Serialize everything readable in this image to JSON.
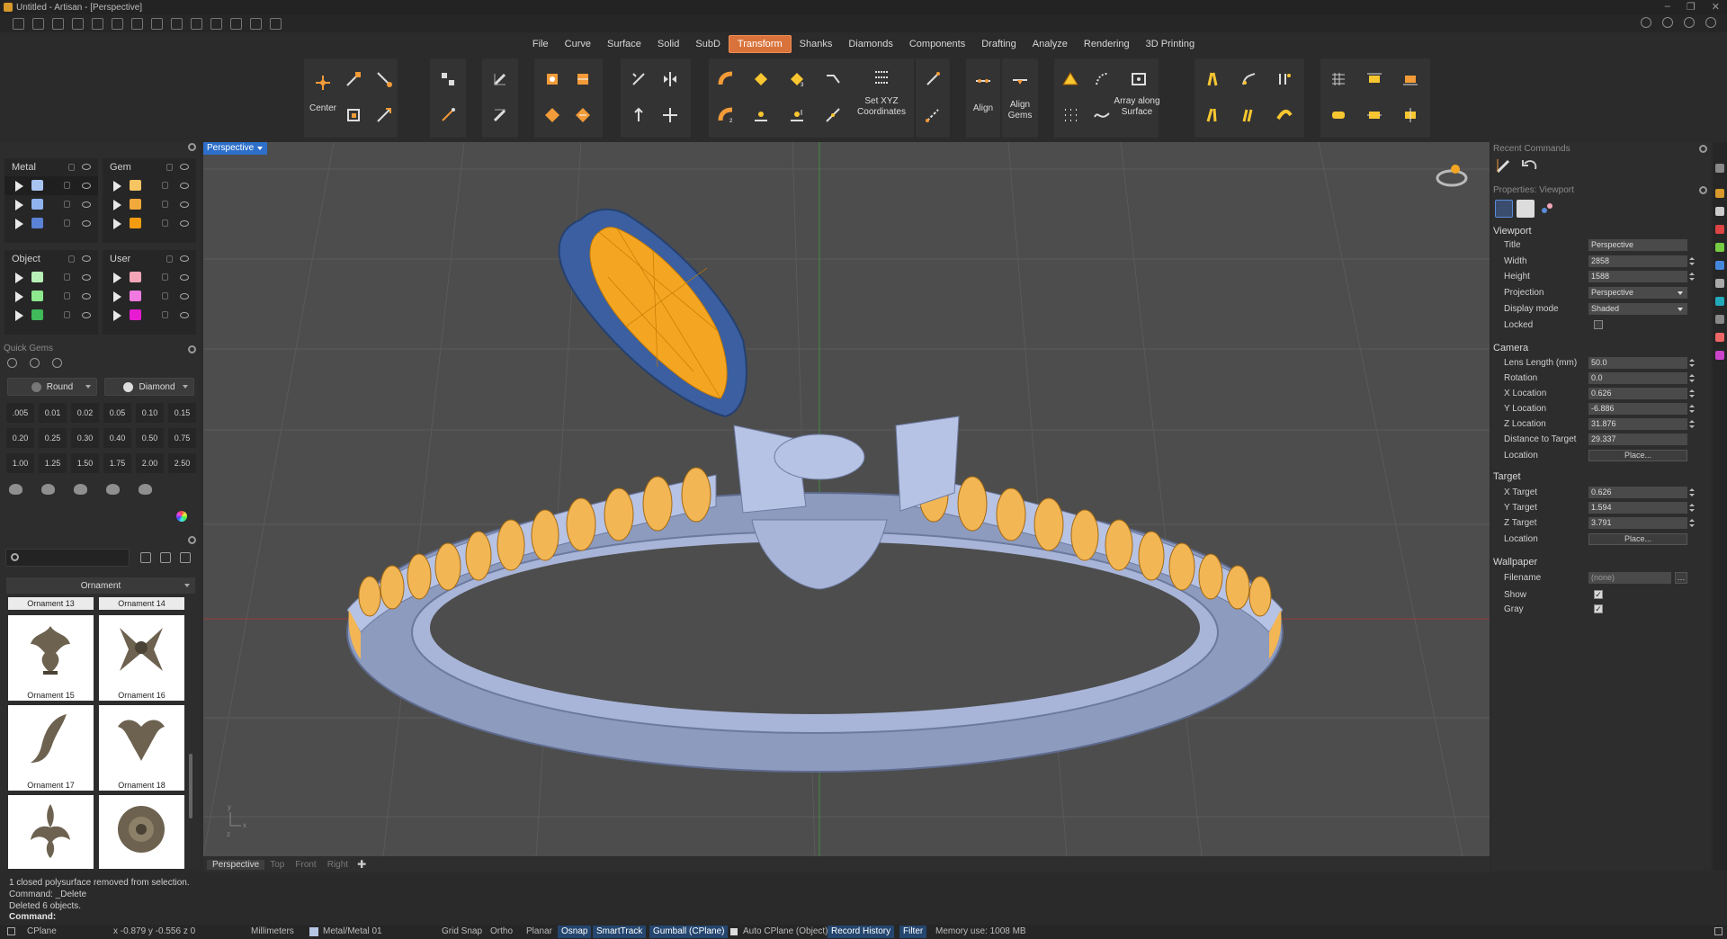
{
  "window": {
    "title": "Untitled - Artisan - [Perspective]"
  },
  "menu": {
    "items": [
      "File",
      "Curve",
      "Surface",
      "Solid",
      "SubD",
      "Transform",
      "Shanks",
      "Diamonds",
      "Components",
      "Drafting",
      "Analyze",
      "Rendering",
      "3D Printing"
    ],
    "active": "Transform"
  },
  "ribbon": {
    "center_label": "Center",
    "set_xyz_label": "Set XYZ\nCoordinates",
    "align_label": "Align",
    "align_gems_label": "Align\nGems",
    "array_surface_label": "Array along\nSurface"
  },
  "layers": {
    "groups": [
      {
        "name": "Metal",
        "colors": [
          "#a9c4f0",
          "#8fb3ef",
          "#5b82d6"
        ]
      },
      {
        "name": "Gem",
        "colors": [
          "#f6c461",
          "#f2a93b",
          "#f39c12"
        ]
      },
      {
        "name": "Object",
        "colors": [
          "#b8f0b8",
          "#8ee88e",
          "#3fb95a"
        ]
      },
      {
        "name": "User",
        "colors": [
          "#f4a6b8",
          "#f07ae0",
          "#e81ad2"
        ]
      }
    ]
  },
  "quick_gems": {
    "title": "Quick Gems",
    "shape": "Round",
    "material": "Diamond",
    "sizes": [
      ".005",
      "0.01",
      "0.02",
      "0.05",
      "0.10",
      "0.15",
      "0.20",
      "0.25",
      "0.30",
      "0.40",
      "0.50",
      "0.75",
      "1.00",
      "1.25",
      "1.50",
      "1.75",
      "2.00",
      "2.50"
    ]
  },
  "library": {
    "search_placeholder": "",
    "category": "Ornament",
    "tabs": [
      "Ornament 13",
      "Ornament 14"
    ],
    "items": [
      "Ornament 15",
      "Ornament 16",
      "Ornament 17",
      "Ornament 18"
    ]
  },
  "viewport": {
    "label": "Perspective",
    "tabs": [
      "Perspective",
      "Top",
      "Front",
      "Right"
    ],
    "active_tab": "Perspective"
  },
  "recent_commands": {
    "title": "Recent Commands"
  },
  "properties": {
    "title": "Properties: Viewport",
    "viewport_group": "Viewport",
    "viewport_rows": [
      {
        "label": "Title",
        "value": "Perspective",
        "kind": "text"
      },
      {
        "label": "Width",
        "value": "2858",
        "kind": "spin"
      },
      {
        "label": "Height",
        "value": "1588",
        "kind": "spin"
      },
      {
        "label": "Projection",
        "value": "Perspective",
        "kind": "dropdown"
      },
      {
        "label": "Display mode",
        "value": "Shaded",
        "kind": "dropdown"
      },
      {
        "label": "Locked",
        "value": "",
        "kind": "check-off"
      }
    ],
    "camera_group": "Camera",
    "camera_rows": [
      {
        "label": "Lens Length (mm)",
        "value": "50.0",
        "kind": "spin"
      },
      {
        "label": "Rotation",
        "value": "0.0",
        "kind": "spin"
      },
      {
        "label": "X Location",
        "value": "0.626",
        "kind": "spin"
      },
      {
        "label": "Y Location",
        "value": "-6.886",
        "kind": "spin"
      },
      {
        "label": "Z Location",
        "value": "31.876",
        "kind": "spin"
      },
      {
        "label": "Distance to Target",
        "value": "29.337",
        "kind": "text"
      },
      {
        "label": "Location",
        "value": "Place...",
        "kind": "button"
      }
    ],
    "target_group": "Target",
    "target_rows": [
      {
        "label": "X Target",
        "value": "0.626",
        "kind": "spin"
      },
      {
        "label": "Y Target",
        "value": "1.594",
        "kind": "spin"
      },
      {
        "label": "Z Target",
        "value": "3.791",
        "kind": "spin"
      },
      {
        "label": "Location",
        "value": "Place...",
        "kind": "button"
      }
    ],
    "wallpaper_group": "Wallpaper",
    "wallpaper_rows": [
      {
        "label": "Filename",
        "value": "(none)",
        "kind": "file"
      },
      {
        "label": "Show",
        "value": "✓",
        "kind": "check-on"
      },
      {
        "label": "Gray",
        "value": "✓",
        "kind": "check-on"
      }
    ]
  },
  "command_history": [
    "1 closed polysurface removed from selection.",
    "Command: _Delete",
    "Deleted 6 objects."
  ],
  "command_prompt": "Command:",
  "status": {
    "cplane": "CPlane",
    "coords": "x -0.879  y -0.556  z 0",
    "units": "Millimeters",
    "layer": "Metal/Metal 01",
    "grid_snap": "Grid Snap",
    "ortho": "Ortho",
    "planar": "Planar",
    "osnap": "Osnap",
    "smarttrack": "SmartTrack",
    "gumball": "Gumball (CPlane)",
    "auto_cplane": "Auto CPlane (Object)",
    "record_history": "Record History",
    "filter": "Filter",
    "memory": "Memory use: 1008 MB"
  }
}
